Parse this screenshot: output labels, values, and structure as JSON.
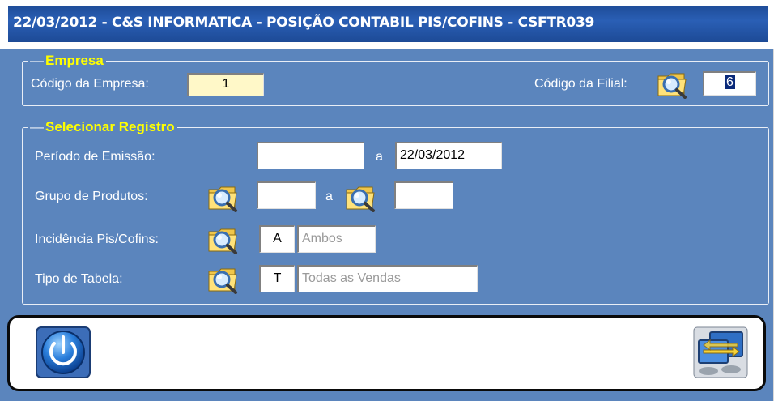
{
  "window": {
    "title": "22/03/2012 - C&S INFORMATICA - POSIÇÃO CONTABIL PIS/COFINS - CSFTR039"
  },
  "empresa": {
    "legend": "Empresa",
    "codigo_empresa_label": "Código da Empresa:",
    "codigo_empresa_value": "1",
    "codigo_filial_label": "Código da Filial:",
    "codigo_filial_value": "6"
  },
  "selecionar": {
    "legend": "Selecionar Registro",
    "periodo_label": "Período de Emissão:",
    "periodo_from": "",
    "separator_a": "a",
    "periodo_to": "22/03/2012",
    "grupo_label": "Grupo de Produtos:",
    "grupo_from": "",
    "grupo_to": "",
    "incidencia_label": "Incidência Pis/Cofins:",
    "incidencia_code": "A",
    "incidencia_desc": "Ambos",
    "tipo_label": "Tipo de Tabela:",
    "tipo_code": "T",
    "tipo_desc": "Todas as Vendas"
  },
  "icons": {
    "lookup": "folder-magnifier-icon",
    "exit": "power-icon",
    "transfer": "monitor-transfer-icon"
  },
  "colors": {
    "form_background": "#5b85bd",
    "title_bar": "#2a5fb5",
    "legend_text": "#ffff00",
    "readonly_field": "#fff8c8"
  }
}
